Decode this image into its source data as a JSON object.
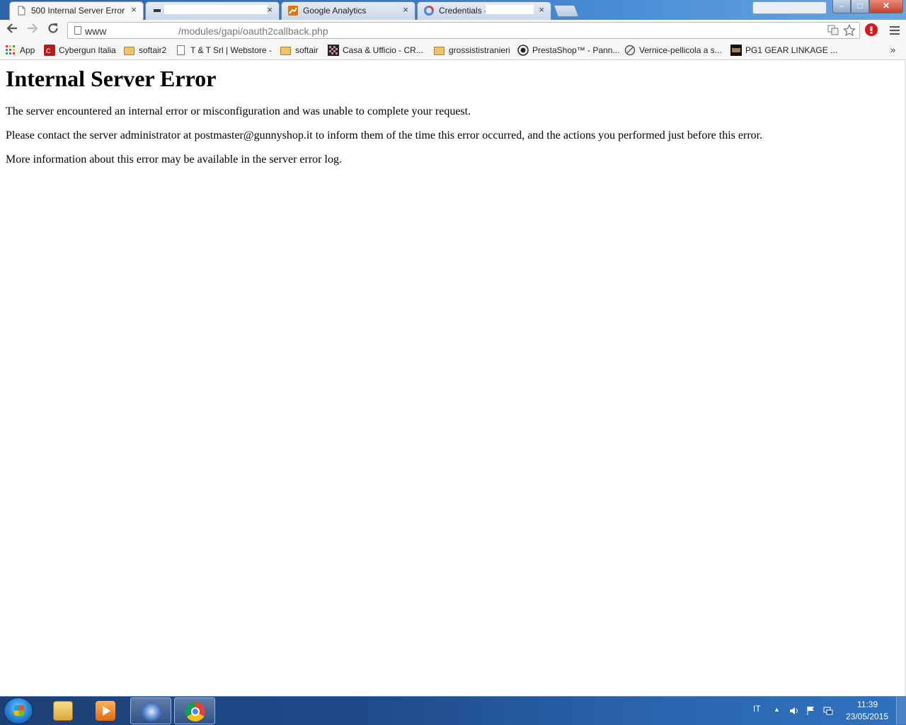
{
  "browser": {
    "tabs": [
      {
        "label": "500 Internal Server Error",
        "favicon": "page-icon",
        "active": true
      },
      {
        "label": "",
        "favicon": "site-icon",
        "active": false
      },
      {
        "label": "Google Analytics",
        "favicon": "analytics-icon",
        "active": false
      },
      {
        "label": "Credentials - ",
        "favicon": "google-cloud-icon",
        "active": false
      }
    ],
    "tab_close_glyph": "×",
    "window_controls": {
      "minimize": "–",
      "maximize": "□",
      "close": "✕"
    },
    "address": {
      "host": "www",
      "path": "/modules/gapi/oauth2callback.php"
    },
    "bookmarks": [
      {
        "label": "App",
        "icon": "apps-grid-icon"
      },
      {
        "label": "Cybergun Italia",
        "icon": "cybergun-icon"
      },
      {
        "label": "softair2",
        "icon": "folder-icon"
      },
      {
        "label": "T & T Srl | Webstore -",
        "icon": "page-icon"
      },
      {
        "label": "softair",
        "icon": "folder-icon"
      },
      {
        "label": "Casa & Ufficio - CR...",
        "icon": "checker-icon"
      },
      {
        "label": "grossististranieri",
        "icon": "folder-icon"
      },
      {
        "label": "PrestaShop™ - Pann...",
        "icon": "prestashop-icon"
      },
      {
        "label": "Vernice-pellicola a s...",
        "icon": "no-entry-icon"
      },
      {
        "label": "PG1 GEAR LINKAGE ...",
        "icon": "product-icon"
      }
    ],
    "bookmarks_more": "»"
  },
  "page": {
    "heading": "Internal Server Error",
    "paragraphs": [
      "The server encountered an internal error or misconfiguration and was unable to complete your request.",
      "Please contact the server administrator at postmaster@gunnyshop.it to inform them of the time this error occurred, and the actions you performed just before this error.",
      "More information about this error may be available in the server error log."
    ]
  },
  "taskbar": {
    "language": "IT",
    "time": "11:39",
    "date": "23/05/2015",
    "apps": [
      {
        "name": "windows-explorer",
        "icon": "folder-icon",
        "running": false
      },
      {
        "name": "media-player",
        "icon": "play-icon",
        "running": false
      },
      {
        "name": "thunderbird",
        "icon": "mail-icon",
        "running": true
      },
      {
        "name": "chrome",
        "icon": "chrome-icon",
        "running": true
      }
    ]
  },
  "colors": {
    "titlebar": "#3b78c2",
    "taskbar": "#1e4a8a",
    "close_button": "#c7402c",
    "page_background": "#ffffff"
  }
}
